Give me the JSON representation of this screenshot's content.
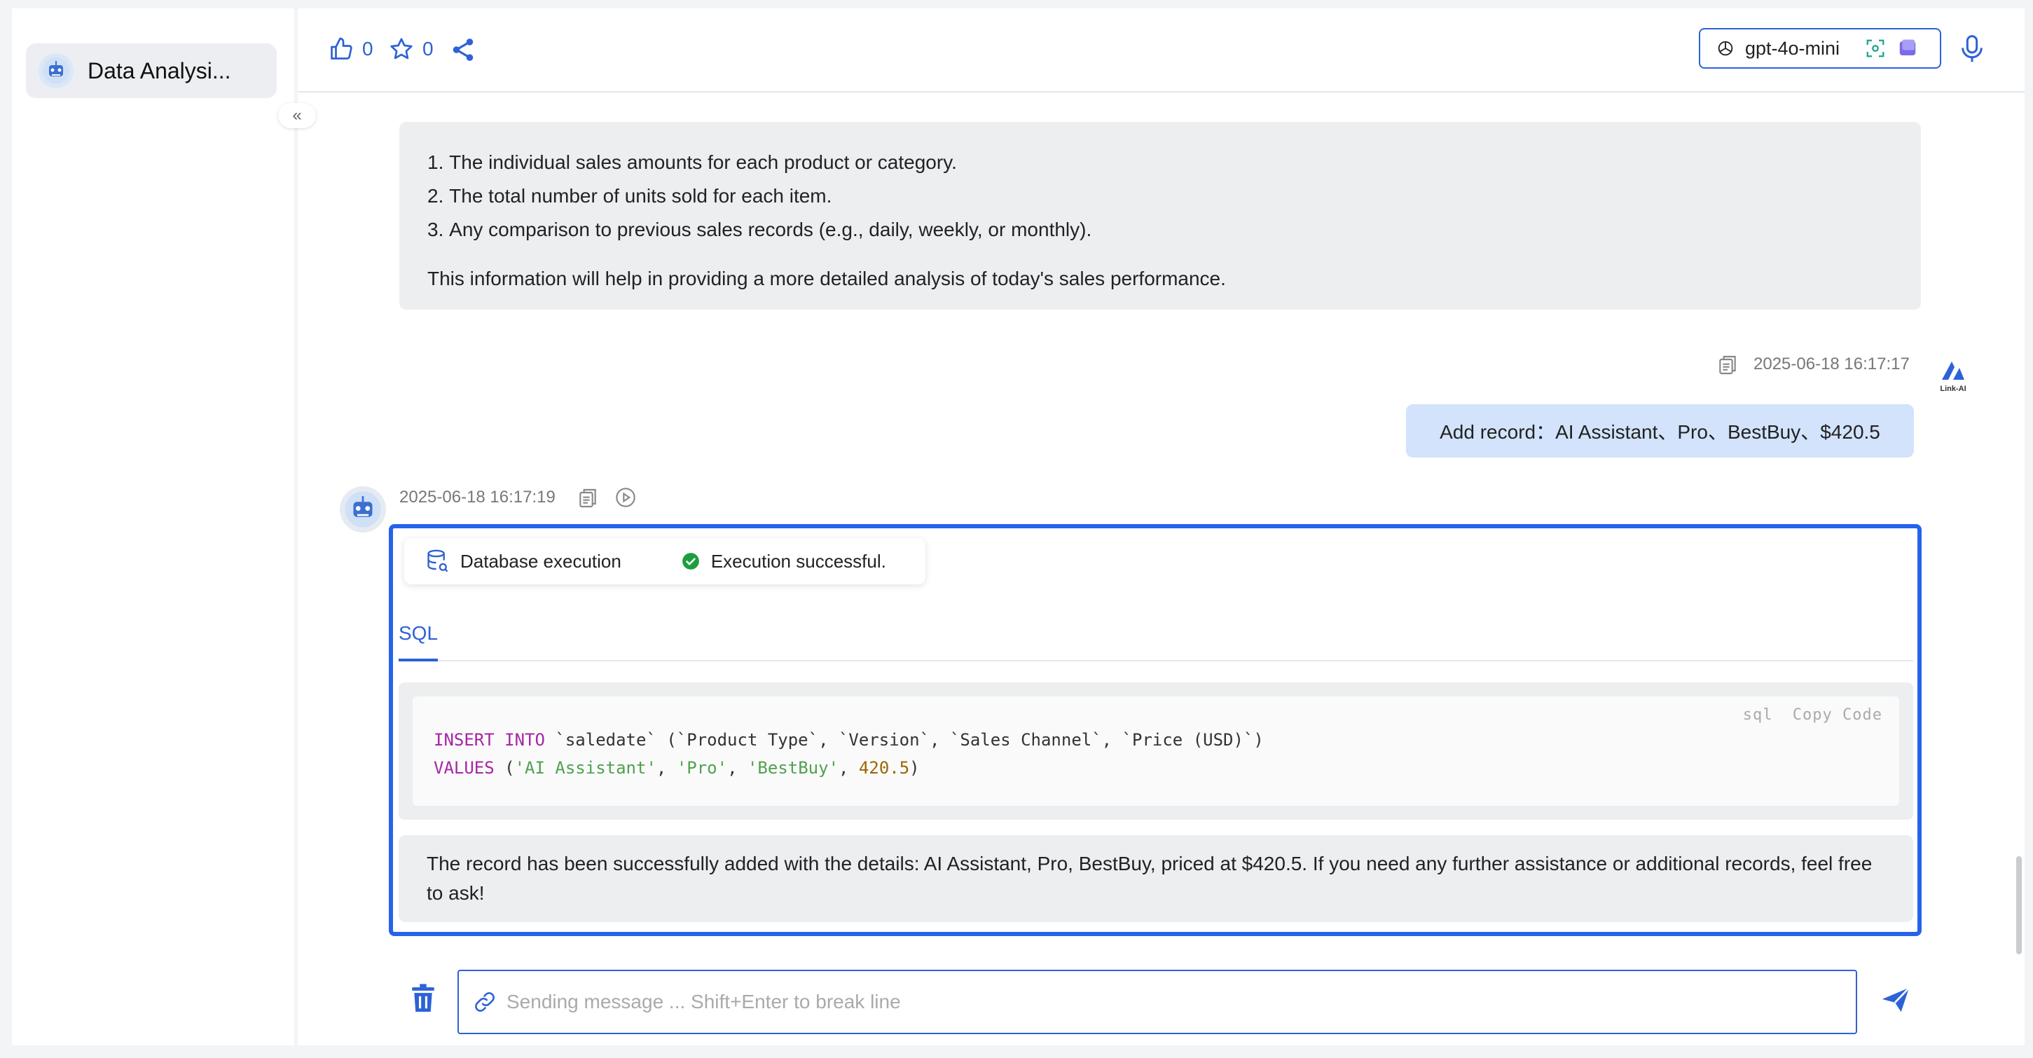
{
  "sidebar": {
    "items": [
      {
        "label": "Data Analysi...",
        "icon": "robot-avatar-icon"
      }
    ],
    "collapse_icon": "«"
  },
  "toolbar": {
    "like_count": "0",
    "favorite_count": "0",
    "model": {
      "label": "gpt-4o-mini"
    }
  },
  "conversation": {
    "prev_reply": {
      "items": [
        "The individual sales amounts for each product or category.",
        "The total number of units sold for each item.",
        "Any comparison to previous sales records (e.g., daily, weekly, or monthly)."
      ],
      "summary": "This information will help in providing a more detailed analysis of today's sales performance."
    },
    "user_msg": {
      "timestamp": "2025-06-18 16:17:17",
      "text": "Add record：AI Assistant、Pro、BestBuy、$420.5",
      "avatar_label": "Link-AI"
    },
    "bot_msg": {
      "timestamp": "2025-06-18 16:17:19",
      "exec_label": "Database execution",
      "exec_status": "Execution successful.",
      "tab": "SQL",
      "code_lang": "sql",
      "copy_label": "Copy Code",
      "code_line1": {
        "kw1": "INSERT INTO",
        "rest": " `saledate` (`Product Type`, `Version`, `Sales Channel`, `Price (USD)`)"
      },
      "code_line2": {
        "kw": "VALUES",
        "open": " (",
        "s1": "'AI Assistant'",
        "sep1": ", ",
        "s2": "'Pro'",
        "sep2": ", ",
        "s3": "'BestBuy'",
        "sep3": ", ",
        "num": "420.5",
        "close": ")"
      },
      "text": "The record has been successfully added with the details: AI Assistant, Pro, BestBuy, priced at $420.5. If you need any further assistance or additional records, feel free to ask!"
    }
  },
  "input": {
    "placeholder": "Sending message ... Shift+Enter to break line",
    "value": ""
  },
  "colors": {
    "accent": "#2d62d6",
    "highlight_border": "#2563eb",
    "user_bubble": "#d2e3fb",
    "bot_bubble": "#eceef0",
    "success": "#1e9e3e"
  }
}
